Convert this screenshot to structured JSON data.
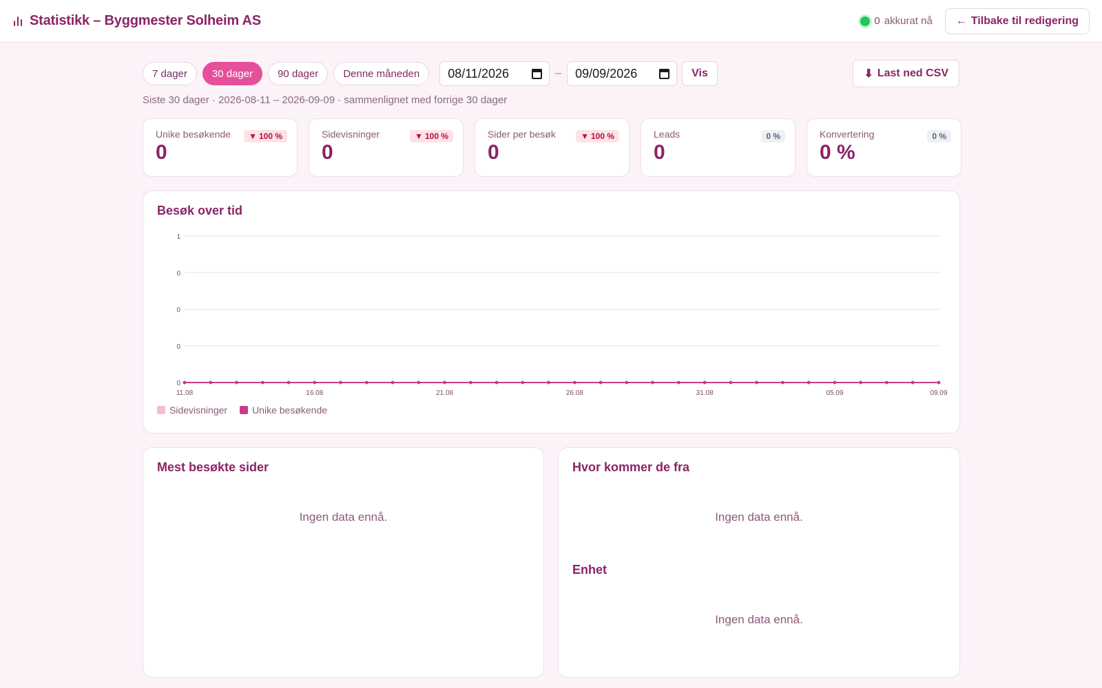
{
  "header": {
    "title": "Statistikk – Byggmester Solheim AS",
    "live_count": "0",
    "live_label": "akkurat nå",
    "back_button": "Tilbake til redigering",
    "back_arrow": "←"
  },
  "filters": {
    "ranges": [
      {
        "label": "7 dager",
        "active": false
      },
      {
        "label": "30 dager",
        "active": true
      },
      {
        "label": "90 dager",
        "active": false
      },
      {
        "label": "Denne måneden",
        "active": false
      }
    ],
    "date_from": "08/11/2026",
    "date_separator": "–",
    "date_to": "09/09/2026",
    "show_button": "Vis",
    "csv_button": "Last ned CSV",
    "csv_icon": "⬇"
  },
  "summary": "Siste 30 dager · 2026-08-11 – 2026-09-09 · sammenlignet med forrige 30 dager",
  "stats": [
    {
      "label": "Unike besøkende",
      "value": "0",
      "change": "100 %",
      "trend": "down"
    },
    {
      "label": "Sidevisninger",
      "value": "0",
      "change": "100 %",
      "trend": "down"
    },
    {
      "label": "Sider per besøk",
      "value": "0",
      "change": "100 %",
      "trend": "down"
    },
    {
      "label": "Leads",
      "value": "0",
      "change": "0 %",
      "trend": "flat"
    },
    {
      "label": "Konvertering",
      "value": "0 %",
      "change": "0 %",
      "trend": "flat"
    }
  ],
  "colors": {
    "accent": "#e54f9b",
    "primary_text": "#8a2468",
    "series_pageviews": "#f4bdd6",
    "series_visitors": "#c83a86",
    "live_dot": "#22c55e"
  },
  "panels": {
    "chart_title": "Besøk over tid",
    "top_pages_title": "Mest besøkte sider",
    "sources_title": "Hvor kommer de fra",
    "device_title": "Enhet",
    "empty_text": "Ingen data ennå."
  },
  "chart_data": {
    "type": "line",
    "title": "Besøk over tid",
    "x": [
      "11.08",
      "12.08",
      "13.08",
      "14.08",
      "15.08",
      "16.08",
      "17.08",
      "18.08",
      "19.08",
      "20.08",
      "21.08",
      "22.08",
      "23.08",
      "24.08",
      "25.08",
      "26.08",
      "27.08",
      "28.08",
      "29.08",
      "30.08",
      "31.08",
      "01.09",
      "02.09",
      "03.09",
      "04.09",
      "05.09",
      "06.09",
      "07.09",
      "08.09",
      "09.09"
    ],
    "x_tick_labels": [
      "11.08",
      "16.08",
      "21.08",
      "26.08",
      "31.08",
      "05.09",
      "09.09"
    ],
    "y_tick_labels": [
      "1",
      "0",
      "0",
      "0",
      "0"
    ],
    "ylim": [
      0,
      1
    ],
    "grid": true,
    "legend_position": "bottom-left",
    "series": [
      {
        "name": "Sidevisninger",
        "values": [
          0,
          0,
          0,
          0,
          0,
          0,
          0,
          0,
          0,
          0,
          0,
          0,
          0,
          0,
          0,
          0,
          0,
          0,
          0,
          0,
          0,
          0,
          0,
          0,
          0,
          0,
          0,
          0,
          0,
          0
        ]
      },
      {
        "name": "Unike besøkende",
        "values": [
          0,
          0,
          0,
          0,
          0,
          0,
          0,
          0,
          0,
          0,
          0,
          0,
          0,
          0,
          0,
          0,
          0,
          0,
          0,
          0,
          0,
          0,
          0,
          0,
          0,
          0,
          0,
          0,
          0,
          0
        ]
      }
    ]
  }
}
